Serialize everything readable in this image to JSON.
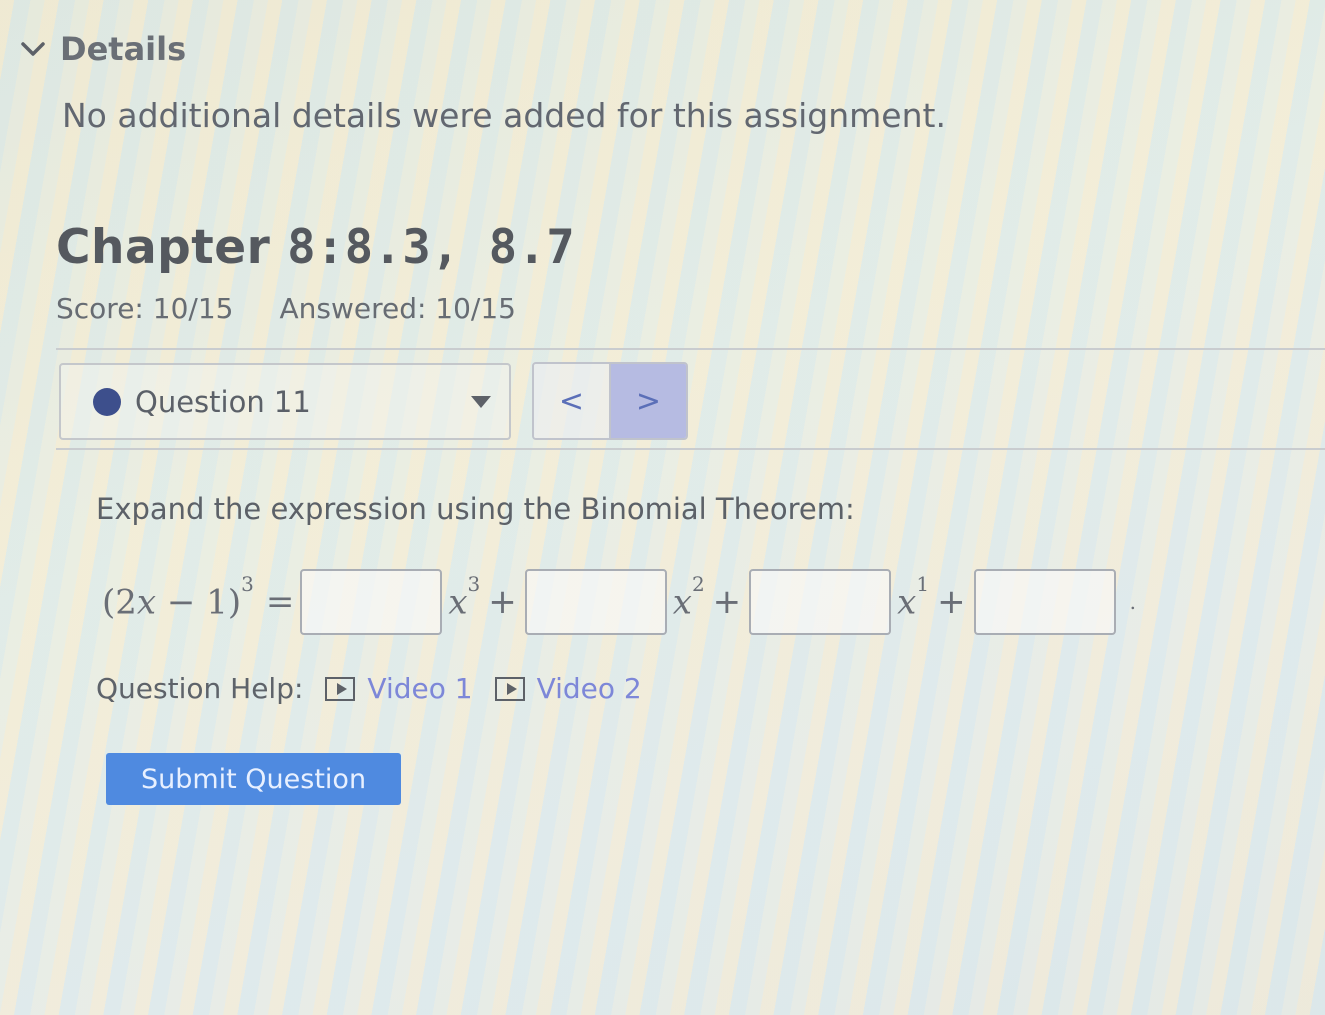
{
  "details": {
    "label": "Details",
    "text": "No additional details were added for this assignment."
  },
  "assignment": {
    "title_word": "Chapter",
    "title_sections": "8:8.3, 8.7",
    "score": "Score: 10/15",
    "answered": "Answered: 10/15"
  },
  "question_nav": {
    "selected": "Question 11",
    "prev_glyph": "<",
    "next_glyph": ">"
  },
  "question": {
    "prompt": "Expand the expression using the Binomial Theorem:",
    "lhs_open": "(2",
    "lhs_var": "x",
    "lhs_rest": " − 1)",
    "lhs_exp": "3",
    "equals": "=",
    "terms": [
      {
        "var": "x",
        "exp": "3",
        "plus": "+"
      },
      {
        "var": "x",
        "exp": "2",
        "plus": "+"
      },
      {
        "var": "x",
        "exp": "1",
        "plus": "+"
      }
    ],
    "period": "."
  },
  "help": {
    "label": "Question Help:",
    "video1": "Video 1",
    "video2": "Video 2"
  },
  "submit_label": "Submit Question",
  "colors": {
    "primary_button": "#4f8ae0",
    "link": "#7d87d8",
    "status_dot": "#3d4f8c",
    "next_button_bg": "#b6bbe2"
  }
}
